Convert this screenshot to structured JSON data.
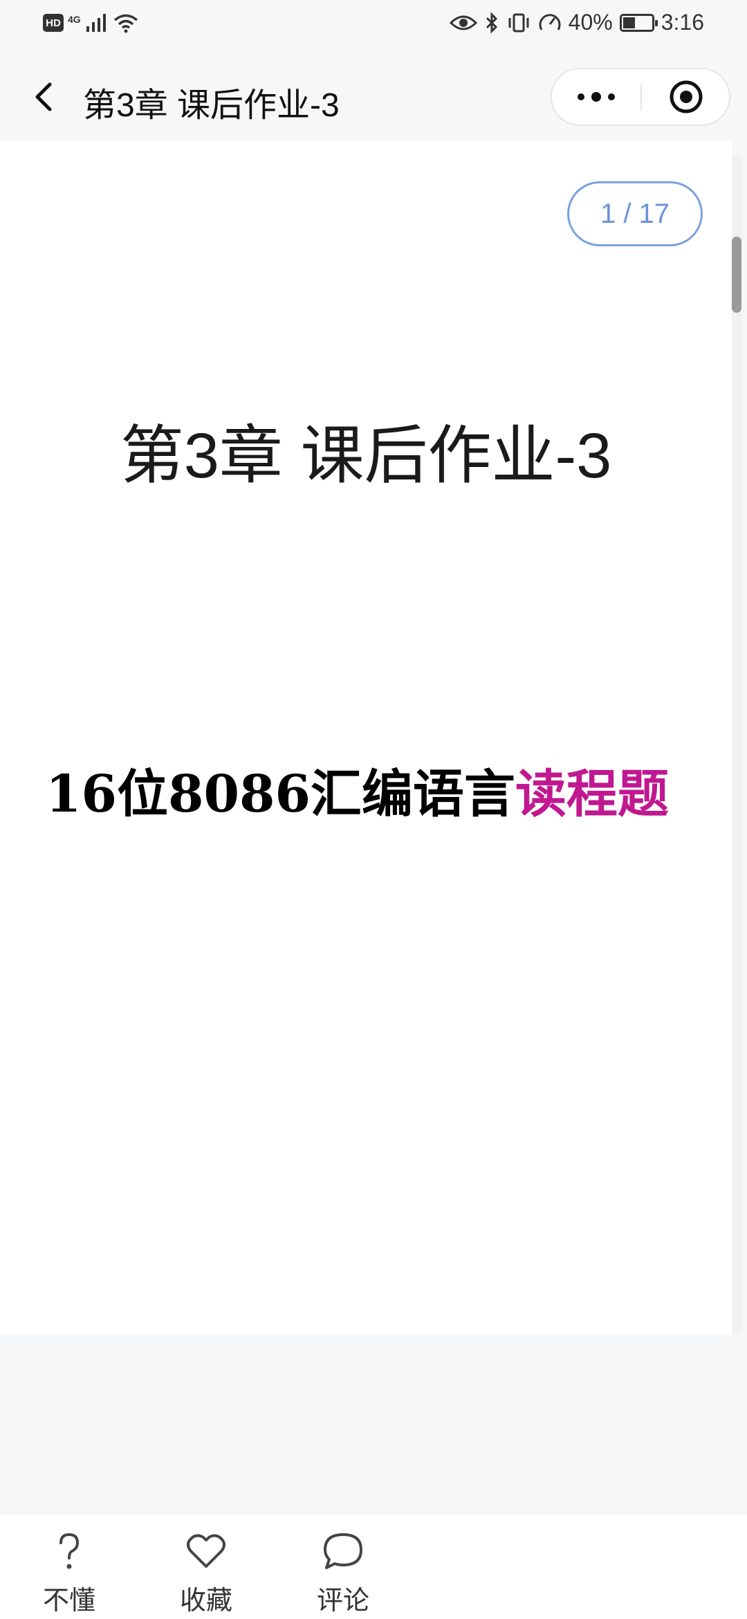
{
  "status_bar": {
    "hd": "HD",
    "network": "4G",
    "battery": "40%",
    "time": "3:16"
  },
  "nav": {
    "title": "第3章 课后作业-3"
  },
  "page": {
    "counter": "1 / 17",
    "title": "第3章 课后作业-3",
    "subtitle_main": "16位8086汇编语言",
    "subtitle_accent": "读程题"
  },
  "colors": {
    "accent": "#c01890",
    "counter": "#6b93db"
  },
  "toolbar": {
    "items": [
      {
        "label": "不懂",
        "icon": "question-icon"
      },
      {
        "label": "收藏",
        "icon": "heart-icon"
      },
      {
        "label": "评论",
        "icon": "comment-icon"
      }
    ]
  }
}
